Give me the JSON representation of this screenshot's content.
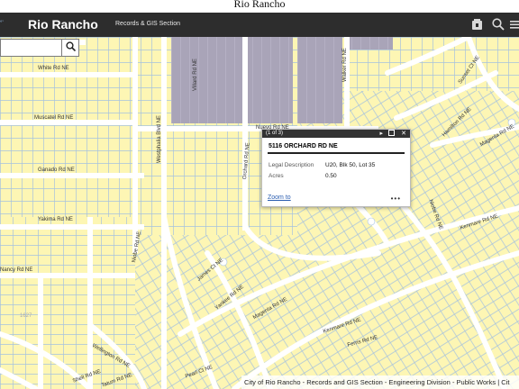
{
  "page_heading": "Rio Rancho",
  "header": {
    "title": "Rio Rancho",
    "subtitle": "Records & GIS Section",
    "logo_text": "°’"
  },
  "icons": {
    "bookmark": "bookmark-icon",
    "search": "search-icon",
    "menu": "menu-icon"
  },
  "search": {
    "value": "",
    "placeholder": ""
  },
  "streets": {
    "white": "White Rd NE",
    "muscatel": "Muscatel Rd NE",
    "ganado": "Ganado Rd NE",
    "yakima": "Yakima Rd NE",
    "westphalia": "Westphalia Blvd NE",
    "villard": "Villard Rd NE",
    "walker": "Walker Rd NE",
    "orchard": "Orchard Rd NE",
    "nuevo": "Nuevo Rd NE",
    "niobe": "Niobe Rd NE",
    "sunset": "Sunset Ct NE",
    "hamilton": "Hamilton Rd NE",
    "magenta_e": "Magenta Rd NE",
    "kenmare_e": "Kenmare Rd NE",
    "nioble": "Niobe Rd NE",
    "james": "James Ct NE",
    "yankee": "Yankee Rd NE",
    "magenta_w": "Magenta Rd NE",
    "kenmare_w": "Kenmare Rd NE",
    "ferris": "Ferris Rd NE",
    "wellington": "Wellington Rd NE",
    "tatum": "Tatum Rd NE",
    "shell": "Shell Rd NE",
    "pearl": "Pearl Ct NE",
    "nancy": "Nancy Rd NE",
    "parcel_num": "1627"
  },
  "popup": {
    "pager": "(1 of 3)",
    "address": "5116 ORCHARD RD NE",
    "rows": [
      {
        "key": "Legal Description",
        "value": "U20, Blk 50, Lot 35"
      },
      {
        "key": "Acres",
        "value": "0.50"
      }
    ],
    "zoom_label": "Zoom to",
    "more_label": "•••"
  },
  "attribution": "City of Rio Rancho - Records and GIS Section - Engineering Division - Public Works | Cit",
  "colors": {
    "parcel_fill": "#fdf6b4",
    "parcel_line": "#9ab8d8",
    "road": "#ffffff",
    "gray_block": "#a9a4b8",
    "header_bg": "#2d2d2d"
  }
}
